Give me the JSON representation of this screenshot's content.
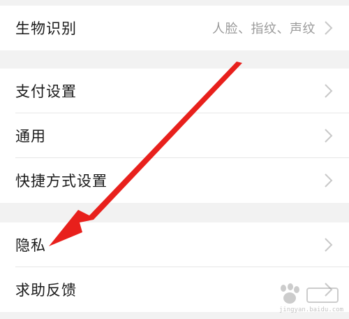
{
  "settings": {
    "group1": [
      {
        "label": "生物识别",
        "value": "人脸、指纹、声纹"
      }
    ],
    "group2": [
      {
        "label": "支付设置"
      },
      {
        "label": "通用"
      },
      {
        "label": "快捷方式设置"
      }
    ],
    "group3": [
      {
        "label": "隐私"
      },
      {
        "label": "求助反馈"
      }
    ]
  },
  "icons": {
    "chevron": "chevron-right-icon",
    "arrow": "red-pointer-arrow",
    "watermark": "baidu-jingyan-watermark"
  },
  "colors": {
    "background": "#f2f2f2",
    "row_bg": "#ffffff",
    "label": "#1a1a1a",
    "value": "#9a9a9a",
    "chevron": "#c8c8c8",
    "arrow": "#e8201c"
  },
  "watermark": {
    "url_text": "jingyan.baidu.com"
  }
}
